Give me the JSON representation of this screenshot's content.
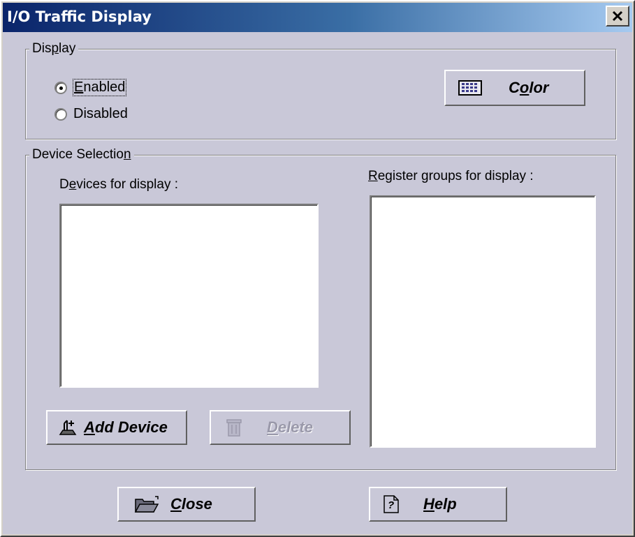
{
  "window": {
    "title": "I/O Traffic Display",
    "close_glyph": "✕"
  },
  "display_group": {
    "legend_before": "Dis",
    "legend_accel": "p",
    "legend_after": "lay",
    "enabled_accel": "E",
    "enabled_rest": "nabled",
    "disabled_label": "Disabled",
    "selected": "Enabled",
    "color_button": {
      "before": "C",
      "accel": "o",
      "after": "lor",
      "icon": "palette-grid-icon"
    }
  },
  "device_group": {
    "legend_before": "Device Selectio",
    "legend_accel": "n",
    "devices_label_before": "D",
    "devices_label_accel": "e",
    "devices_label_after": "vices for display :",
    "registers_label_accel": "R",
    "registers_label_after": "egister groups for display :",
    "devices_items": [],
    "register_items": [],
    "add_button": {
      "accel": "A",
      "rest": "dd Device",
      "icon": "add-device-icon"
    },
    "delete_button": {
      "accel": "D",
      "rest": "elete",
      "icon": "trash-icon",
      "enabled": false
    }
  },
  "footer": {
    "close_button": {
      "accel": "C",
      "rest": "lose",
      "icon": "open-folder-icon"
    },
    "help_button": {
      "accel": "H",
      "rest": "elp",
      "icon": "help-page-icon"
    }
  },
  "colors": {
    "panel": "#c9c8d8",
    "title_gradient_start": "#0a246a",
    "title_gradient_end": "#a6caf0"
  }
}
